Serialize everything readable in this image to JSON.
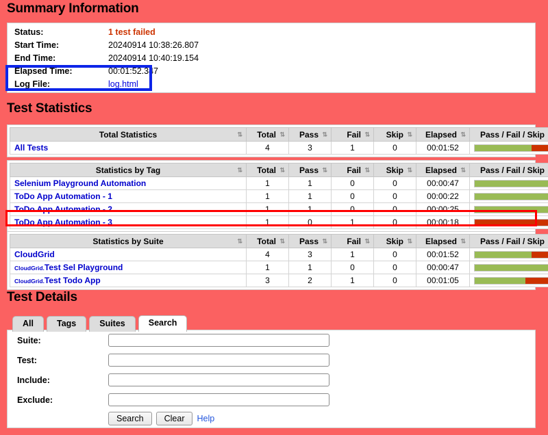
{
  "sections": {
    "summary_title": "Summary Information",
    "statistics_title": "Test Statistics",
    "details_title": "Test Details"
  },
  "summary": {
    "rows": [
      {
        "label": "Status:",
        "value": "1 test failed",
        "kind": "status-failed"
      },
      {
        "label": "Start Time:",
        "value": "20240914 10:38:26.807",
        "kind": "text"
      },
      {
        "label": "End Time:",
        "value": "20240914 10:40:19.154",
        "kind": "text"
      },
      {
        "label": "Elapsed Time:",
        "value": "00:01:52.347",
        "kind": "text"
      },
      {
        "label": "Log File:",
        "value": "log.html",
        "kind": "link"
      }
    ]
  },
  "columns": {
    "total": "Total",
    "pass": "Pass",
    "fail": "Fail",
    "skip": "Skip",
    "elapsed": "Elapsed",
    "graph": "Pass / Fail / Skip",
    "sort_icon": "sort-arrows-icon"
  },
  "total_statistics": {
    "header": "Total Statistics",
    "rows": [
      {
        "name": "All Tests",
        "total": "4",
        "pass": "3",
        "fail": "1",
        "skip": "0",
        "elapsed": "00:01:52",
        "pass_pct": 75,
        "fail_pct": 25
      }
    ]
  },
  "tag_statistics": {
    "header": "Statistics by Tag",
    "rows": [
      {
        "name": "Selenium Playground Automation",
        "total": "1",
        "pass": "1",
        "fail": "0",
        "skip": "0",
        "elapsed": "00:00:47",
        "pass_pct": 100,
        "fail_pct": 0
      },
      {
        "name": "ToDo App Automation - 1",
        "total": "1",
        "pass": "1",
        "fail": "0",
        "skip": "0",
        "elapsed": "00:00:22",
        "pass_pct": 100,
        "fail_pct": 0
      },
      {
        "name": "ToDo App Automation - 2",
        "total": "1",
        "pass": "1",
        "fail": "0",
        "skip": "0",
        "elapsed": "00:00:25",
        "pass_pct": 100,
        "fail_pct": 0
      },
      {
        "name": "ToDo App Automation - 3",
        "total": "1",
        "pass": "0",
        "fail": "1",
        "skip": "0",
        "elapsed": "00:00:18",
        "pass_pct": 0,
        "fail_pct": 100
      }
    ]
  },
  "suite_statistics": {
    "header": "Statistics by Suite",
    "rows": [
      {
        "prefix": "",
        "name": "CloudGrid",
        "total": "4",
        "pass": "3",
        "fail": "1",
        "skip": "0",
        "elapsed": "00:01:52",
        "pass_pct": 75,
        "fail_pct": 25
      },
      {
        "prefix": "CloudGrid.",
        "name": "Test Sel Playground",
        "total": "1",
        "pass": "1",
        "fail": "0",
        "skip": "0",
        "elapsed": "00:00:47",
        "pass_pct": 100,
        "fail_pct": 0
      },
      {
        "prefix": "CloudGrid.",
        "name": "Test Todo App",
        "total": "3",
        "pass": "2",
        "fail": "1",
        "skip": "0",
        "elapsed": "00:01:05",
        "pass_pct": 67,
        "fail_pct": 33
      }
    ]
  },
  "details": {
    "tabs": [
      {
        "label": "All",
        "active": false
      },
      {
        "label": "Tags",
        "active": false
      },
      {
        "label": "Suites",
        "active": false
      },
      {
        "label": "Search",
        "active": true
      }
    ],
    "fields": [
      {
        "label": "Suite:",
        "value": "",
        "placeholder": ""
      },
      {
        "label": "Test:",
        "value": "",
        "placeholder": ""
      },
      {
        "label": "Include:",
        "value": "",
        "placeholder": ""
      },
      {
        "label": "Exclude:",
        "value": "",
        "placeholder": ""
      }
    ],
    "search_button": "Search",
    "clear_button": "Clear",
    "help_link": "Help"
  },
  "annotations": {
    "blue_box_color": "#0d25e8",
    "red_box_color": "#ff0000"
  },
  "colors": {
    "background": "#fb6161",
    "pass_bar": "#99bb55",
    "fail_bar": "#cc3300",
    "failed_text": "#cc3300",
    "link": "#0000cc"
  }
}
